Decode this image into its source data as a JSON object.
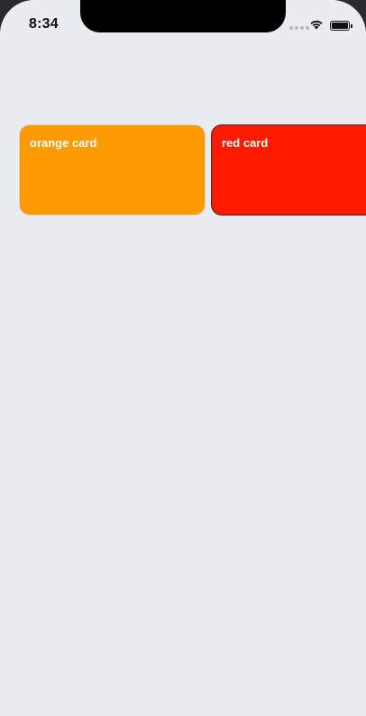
{
  "status_bar": {
    "time": "8:34"
  },
  "cards": [
    {
      "label": "orange card",
      "color": "#ff9a00"
    },
    {
      "label": "red card",
      "color": "#ff1a00"
    }
  ],
  "colors": {
    "background": "#e9ecf0",
    "notch": "#000000"
  },
  "icons": [
    "signal-icon",
    "wifi-icon",
    "battery-icon"
  ]
}
